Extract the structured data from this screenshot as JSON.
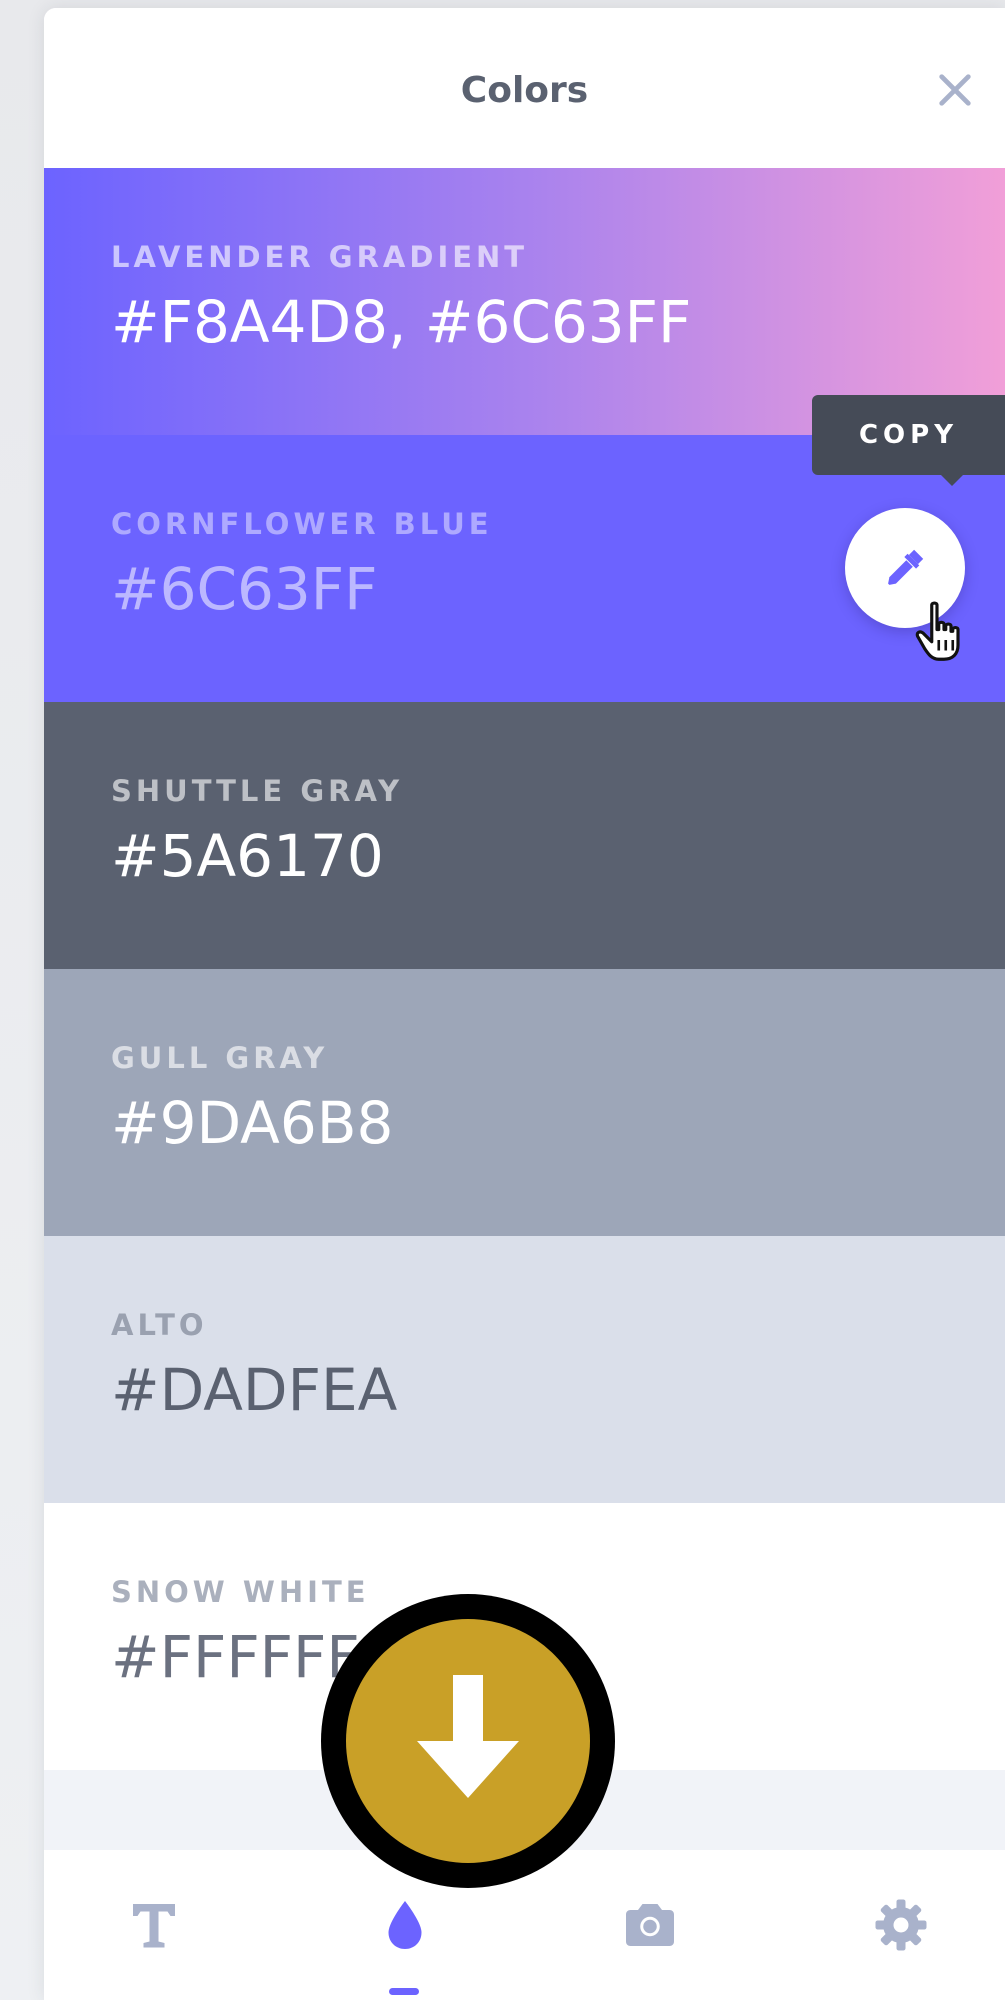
{
  "header": {
    "title": "Colors",
    "close_icon": "close-icon"
  },
  "swatches": [
    {
      "name": "LAVENDER GRADIENT",
      "hex": "#F8A4D8, #6C63FF",
      "colors": [
        "#6C63FF",
        "#F19FD8"
      ]
    },
    {
      "name": "CORNFLOWER BLUE",
      "hex": "#6C63FF",
      "color": "#6C63FF"
    },
    {
      "name": "SHUTTLE GRAY",
      "hex": "#5A6170",
      "color": "#5A6170"
    },
    {
      "name": "GULL GRAY",
      "hex": "#9DA6B8",
      "color": "#9DA6B8"
    },
    {
      "name": "ALTO",
      "hex": "#DADFEA",
      "color": "#DADFEA"
    },
    {
      "name": "SNOW WHITE",
      "hex": "#FFFFFF",
      "color": "#FFFFFF"
    }
  ],
  "tooltip": {
    "label": "COPY"
  },
  "picker": {
    "icon": "eyedropper-icon",
    "cursor_icon": "hand-pointer-icon"
  },
  "bottom_nav": {
    "items": [
      {
        "icon": "text-icon",
        "active": false
      },
      {
        "icon": "drop-icon",
        "active": true
      },
      {
        "icon": "camera-icon",
        "active": false
      },
      {
        "icon": "gear-icon",
        "active": false
      }
    ]
  },
  "overlay": {
    "icon": "download-arrow-icon",
    "color": "#C9A027"
  },
  "colors": {
    "accent": "#6C63FF",
    "text_dark": "#5A6170",
    "icon_muted": "#A9B2CB"
  }
}
